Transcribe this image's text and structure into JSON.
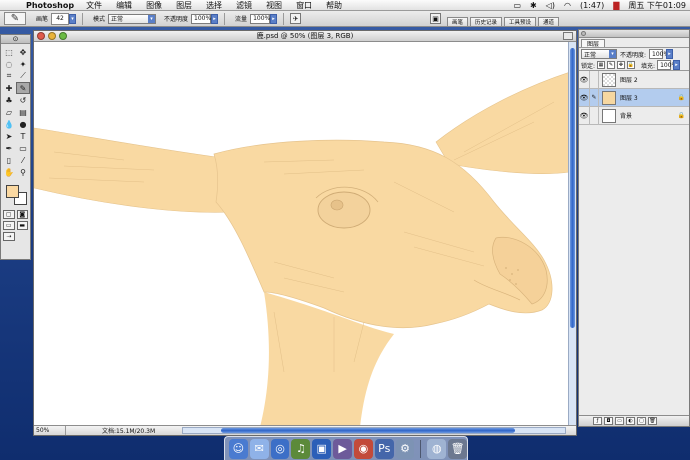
{
  "menubar": {
    "app_name": "Photoshop",
    "items": [
      "文件",
      "编辑",
      "图像",
      "图层",
      "选择",
      "滤镜",
      "视图",
      "窗口",
      "帮助"
    ],
    "battery": "(1:47)",
    "clock": "周五 下午01:09"
  },
  "options": {
    "brush_label": "画笔",
    "brush_size": "42",
    "mode_label": "模式",
    "mode_value": "正常",
    "opacity_label": "不透明度",
    "opacity_value": "100%",
    "flow_label": "流量",
    "flow_value": "100%",
    "palette_tabs": [
      "画笔",
      "历史记录",
      "工具预设",
      "通道"
    ]
  },
  "document": {
    "title": "鹿.psd @ 50% (图层 3, RGB)",
    "zoom": "50%",
    "doc_info": "文档:15.1M/20.3M"
  },
  "layers_palette": {
    "tab": "图层",
    "blend_mode": "正常",
    "opacity_label": "不透明度:",
    "opacity_value": "100%",
    "lock_label": "锁定:",
    "fill_label": "填充:",
    "fill_value": "100%",
    "layers": [
      {
        "name": "图层 2",
        "active": false
      },
      {
        "name": "图层 3",
        "active": true
      },
      {
        "name": "背景",
        "active": false
      }
    ]
  },
  "colors": {
    "foreground": "#fbd9a2",
    "background": "#ffffff",
    "deer_fill": "#f9d9a2",
    "deer_stroke": "#d9b47c"
  }
}
